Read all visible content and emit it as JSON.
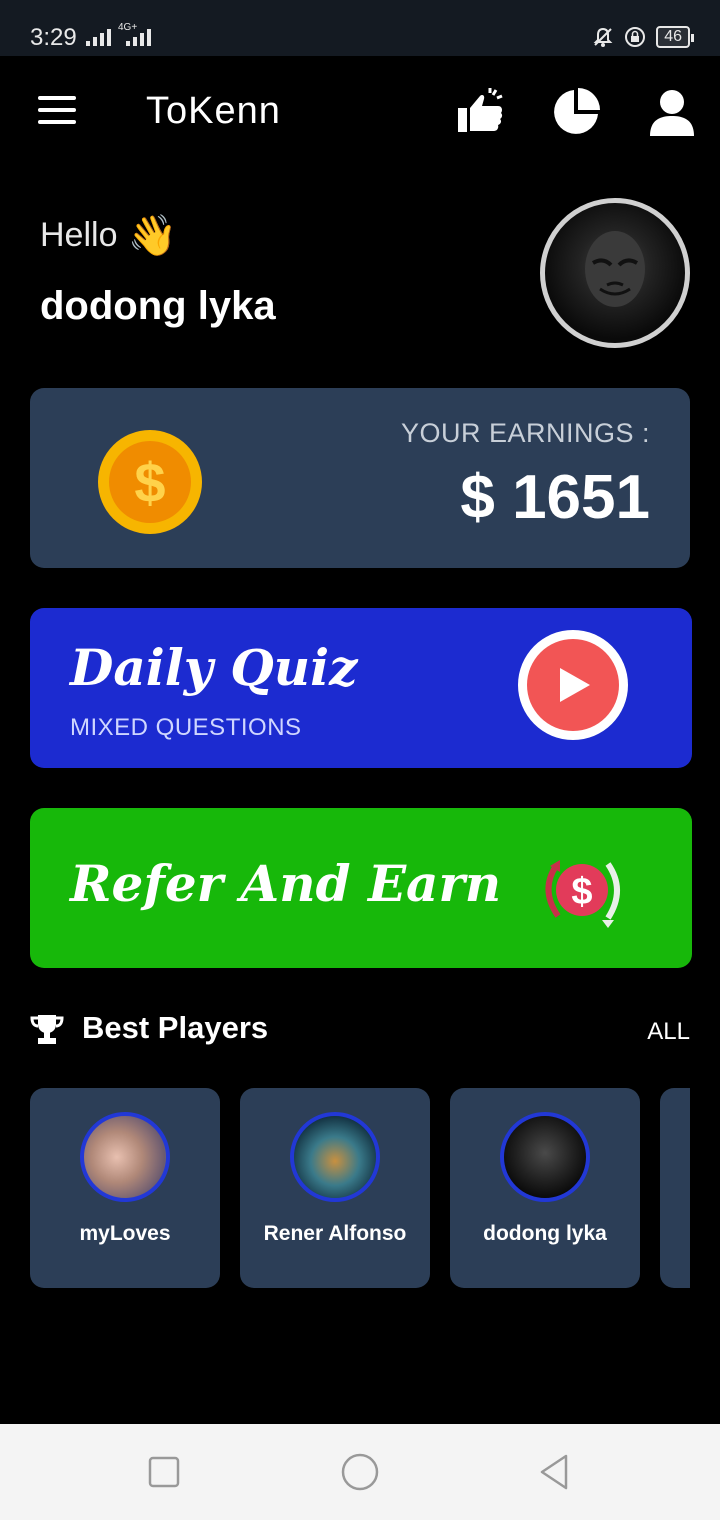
{
  "status_bar": {
    "time": "3:29",
    "network": "4G+",
    "battery": "46"
  },
  "app": {
    "title": "ToKenn"
  },
  "greeting": {
    "hello": "Hello",
    "wave_emoji": "👋",
    "user_name": "dodong lyka"
  },
  "earnings": {
    "label": "YOUR EARNINGS :",
    "value": "$ 1651"
  },
  "daily_quiz": {
    "title": "Daily Quiz",
    "subtitle": "MIXED QUESTIONS"
  },
  "refer": {
    "title": "Refer And Earn"
  },
  "best_players": {
    "title": "Best Players",
    "all_label": "ALL",
    "players": [
      {
        "name": "myLoves"
      },
      {
        "name": "Rener Alfonso"
      },
      {
        "name": "dodong lyka"
      }
    ]
  },
  "colors": {
    "card_dark": "#2c3e57",
    "quiz_blue": "#1c2bd0",
    "refer_green": "#17b80a",
    "play_red": "#f25555",
    "coin_gold": "#f7b500"
  },
  "icons": {
    "menu": "menu-icon",
    "like": "thumbs-up-icon",
    "stats": "pie-chart-icon",
    "profile": "user-icon",
    "trophy": "trophy-icon",
    "play": "play-icon",
    "refer": "refer-dollar-icon"
  }
}
